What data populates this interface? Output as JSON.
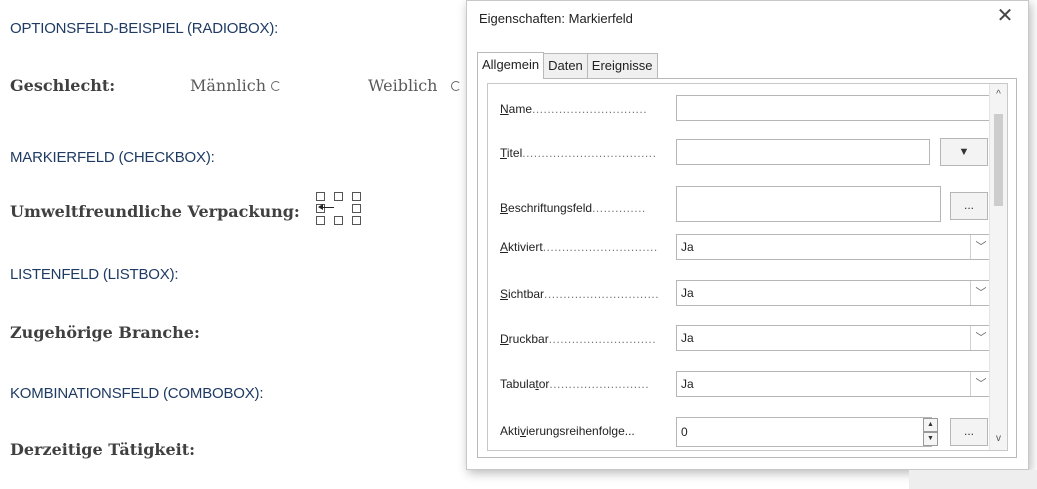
{
  "document": {
    "section_radio": "OPTIONSFELD-BEISPIEL (RADIOBOX):",
    "label_gender": "Geschlecht:",
    "option_male": "Männlich",
    "option_female": "Weiblich",
    "section_checkbox": "MARKIERFELD (CHECKBOX):",
    "label_packaging": "Umweltfreundliche Verpackung:",
    "section_listbox": "LISTENFELD (LISTBOX):",
    "label_industry": "Zugehörige Branche:",
    "section_combobox": "KOMBINATIONSFELD (COMBOBOX):",
    "label_activity": "Derzeitige Tätigkeit:"
  },
  "dialog": {
    "title": "Eigenschaften: Markierfeld",
    "close_label": "✕",
    "tabs": [
      "Allgemein",
      "Daten",
      "Ereignisse"
    ],
    "active_tab": "Allgemein",
    "properties": {
      "name": {
        "label_pre": "",
        "label_ul": "N",
        "label_post": "ame",
        "dots": "..............................",
        "value": ""
      },
      "title": {
        "label_pre": "",
        "label_ul": "T",
        "label_post": "itel",
        "dots": "...................................",
        "value": "",
        "dropdown_arrow": "▼"
      },
      "label_field": {
        "label_pre": "",
        "label_ul": "B",
        "label_post": "eschriftungsfeld",
        "dots": "..............",
        "value": "",
        "button": "..."
      },
      "enabled": {
        "label_pre": "",
        "label_ul": "A",
        "label_post": "ktiviert",
        "dots": "..............................",
        "value": "Ja"
      },
      "visible": {
        "label_pre": "",
        "label_ul": "S",
        "label_post": "ichtbar",
        "dots": "..............................",
        "value": "Ja"
      },
      "printable": {
        "label_pre": "",
        "label_ul": "D",
        "label_post": "ruckbar",
        "dots": "............................",
        "value": "Ja"
      },
      "tabstop": {
        "label_pre": "Tabula",
        "label_ul": "t",
        "label_post": "or",
        "dots": "..........................",
        "value": "Ja"
      },
      "tab_order": {
        "label_pre": "Akti",
        "label_ul": "v",
        "label_post": "ierungsreihenfolge...",
        "dots": "",
        "value": "0",
        "button": "..."
      }
    },
    "select_arrow": "﹀",
    "scroll_up": "^",
    "scroll_down": "v",
    "spin_up": "▲",
    "spin_down": "▼"
  }
}
